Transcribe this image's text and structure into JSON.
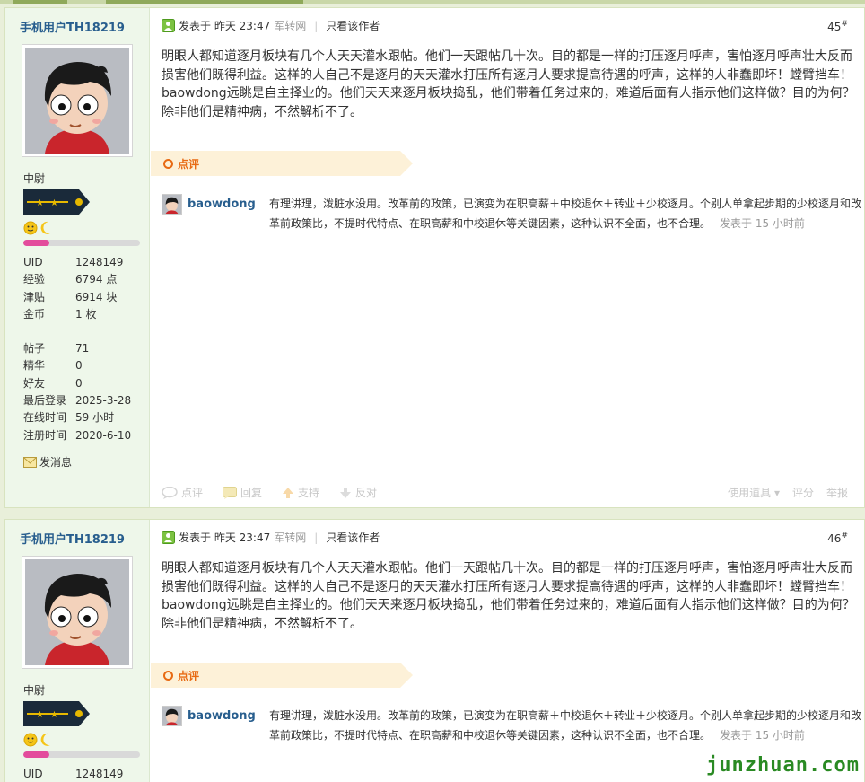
{
  "posts": [
    {
      "user": {
        "name": "手机用户TH18219",
        "rank": "中尉",
        "stats": [
          {
            "k": "UID",
            "v": "1248149"
          },
          {
            "k": "经验",
            "v": "6794 点"
          },
          {
            "k": "津贴",
            "v": "6914 块"
          },
          {
            "k": "金币",
            "v": "1 枚"
          }
        ],
        "stats2": [
          {
            "k": "帖子",
            "v": "71"
          },
          {
            "k": "精华",
            "v": "0"
          },
          {
            "k": "好友",
            "v": "0"
          },
          {
            "k": "最后登录",
            "v": "2025-3-28"
          },
          {
            "k": "在线时间",
            "v": "59 小时"
          },
          {
            "k": "注册时间",
            "v": "2020-6-10"
          }
        ],
        "send_msg": "发消息",
        "progress": 0.22
      },
      "meta": {
        "posted": "发表于 昨天 23:47",
        "via": "军转网",
        "only_author": "只看该作者"
      },
      "floor": "45",
      "content": "明眼人都知道逐月板块有几个人天天灌水跟帖。他们一天跟帖几十次。目的都是一样的打压逐月呼声，害怕逐月呼声壮大反而损害他们既得利益。这样的人自己不是逐月的天天灌水打压所有逐月人要求提高待遇的呼声，这样的人非蠢即坏！螳臂挡车！baowdong远眺是自主择业的。他们天天来逐月板块捣乱，他们带着任务过来的，难道后面有人指示他们这样做？目的为何？除非他们是精神病，不然解析不了。",
      "comment_label": "点评",
      "comment": {
        "user": "baowdong",
        "text": "有理讲理，泼脏水没用。改革前的政策，已演变为在职高薪＋中校退休＋转业＋少校逐月。个别人单拿起步期的少校逐月和改革前政策比，不提时代特点、在职高薪和中校退休等关键因素，这种认识不全面，也不合理。",
        "time": "发表于 15 小时前"
      },
      "actions": {
        "comment": "点评",
        "reply": "回复",
        "support": "支持",
        "oppose": "反对",
        "tools": "使用道具",
        "rate": "评分",
        "report": "举报"
      }
    },
    {
      "user": {
        "name": "手机用户TH18219",
        "rank": "中尉",
        "stats": [
          {
            "k": "UID",
            "v": "1248149"
          }
        ],
        "progress": 0.22
      },
      "meta": {
        "posted": "发表于 昨天 23:47",
        "via": "军转网",
        "only_author": "只看该作者"
      },
      "floor": "46",
      "content": "明眼人都知道逐月板块有几个人天天灌水跟帖。他们一天跟帖几十次。目的都是一样的打压逐月呼声，害怕逐月呼声壮大反而损害他们既得利益。这样的人自己不是逐月的天天灌水打压所有逐月人要求提高待遇的呼声，这样的人非蠢即坏！螳臂挡车！baowdong远眺是自主择业的。他们天天来逐月板块捣乱，他们带着任务过来的，难道后面有人指示他们这样做？目的为何？除非他们是精神病，不然解析不了。",
      "comment_label": "点评",
      "comment": {
        "user": "baowdong",
        "text": "有理讲理，泼脏水没用。改革前的政策，已演变为在职高薪＋中校退休＋转业＋少校逐月。个别人单拿起步期的少校逐月和改革前政策比，不提时代特点、在职高薪和中校退休等关键因素，这种认识不全面，也不合理。",
        "time": "发表于 15 小时前"
      }
    }
  ],
  "watermark": "junzhuan.com",
  "colors": {
    "accent": "#285e8e",
    "comment_orange": "#e86a13",
    "sidebar_bg": "#eef7ea"
  }
}
